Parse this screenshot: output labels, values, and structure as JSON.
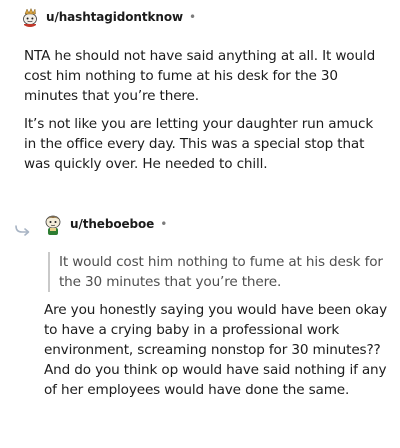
{
  "comments": [
    {
      "username": "u/hashtagidontknow",
      "separator": "•",
      "avatar_icon": "snoo-avatar-icon",
      "paragraphs": [
        "NTA he should not have said anything at all. It would cost him nothing to fume at his desk for the 30 minutes that you’re there.",
        "It’s not like you are letting your daughter run amuck in the office every day. This was a special stop that was quickly over. He needed to chill."
      ]
    },
    {
      "username": "u/theboeboe",
      "separator": "•",
      "avatar_icon": "snoo-avatar-icon",
      "reply_icon": "reply-arrow-icon",
      "quote": "It would cost him nothing to fume at his desk for the 30 minutes that you’re there.",
      "paragraphs": [
        "Are you honestly saying you would have been okay to have a crying baby in a professional work environment, screaming nonstop for 30 minutes?? And do you think op would have said nothing if any of her employees would have done the same."
      ]
    }
  ],
  "colors": {
    "text": "#1c1c1c",
    "meta": "#7c7c7c",
    "quote_text": "#4f4f4f",
    "quote_bar": "#c9c9c9",
    "reply_arrow": "#a8b4c4"
  }
}
